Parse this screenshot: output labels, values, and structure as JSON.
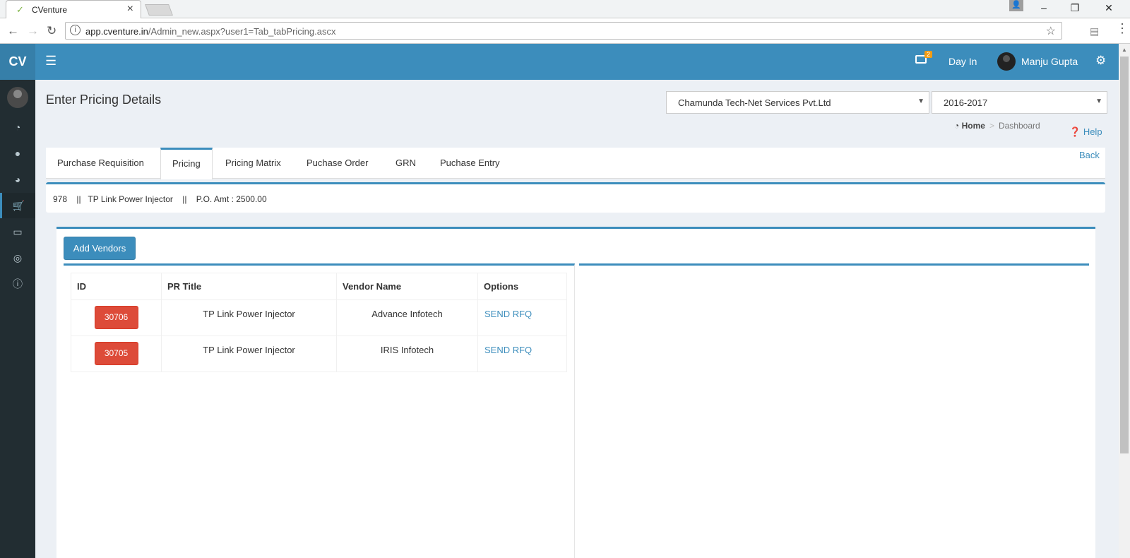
{
  "browser": {
    "tab_title": "CVenture",
    "url_host": "app.cventure.in",
    "url_path": "/Admin_new.aspx?user1=Tab_tabPricing.ascx"
  },
  "header": {
    "logo": "CV",
    "notification_count": "2",
    "day_in": "Day In",
    "user_name": "Manju Gupta"
  },
  "page": {
    "title": "Enter Pricing Details",
    "company_select": "Chamunda Tech-Net Services Pvt.Ltd",
    "year_select": "2016-2017",
    "breadcrumb": {
      "home": "Home",
      "current": "Dashboard"
    },
    "help": "Help",
    "back": "Back"
  },
  "tabs": [
    {
      "label": "Purchase Requisition"
    },
    {
      "label": "Pricing"
    },
    {
      "label": "Pricing Matrix"
    },
    {
      "label": "Puchase Order"
    },
    {
      "label": "GRN"
    },
    {
      "label": "Puchase Entry"
    }
  ],
  "info_line": "978    ||   TP Link Power Injector    ||    P.O. Amt : 2500.00",
  "add_vendors_label": "Add Vendors",
  "table": {
    "headers": {
      "id": "ID",
      "pr_title": "PR Title",
      "vendor": "Vendor Name",
      "options": "Options"
    },
    "rows": [
      {
        "id": "30706",
        "pr_title": "TP Link Power Injector",
        "vendor": "Advance Infotech",
        "option": "SEND RFQ"
      },
      {
        "id": "30705",
        "pr_title": "TP Link Power Injector",
        "vendor": "IRIS Infotech",
        "option": "SEND RFQ"
      }
    ]
  },
  "icons": {
    "sidebar": [
      "dashboard-icon",
      "user-icon",
      "pie-chart-icon",
      "cart-icon",
      "credit-card-icon",
      "globe-icon",
      "info-icon"
    ],
    "accent_color": "#3c8dbc",
    "danger_color": "#dd4b39"
  }
}
